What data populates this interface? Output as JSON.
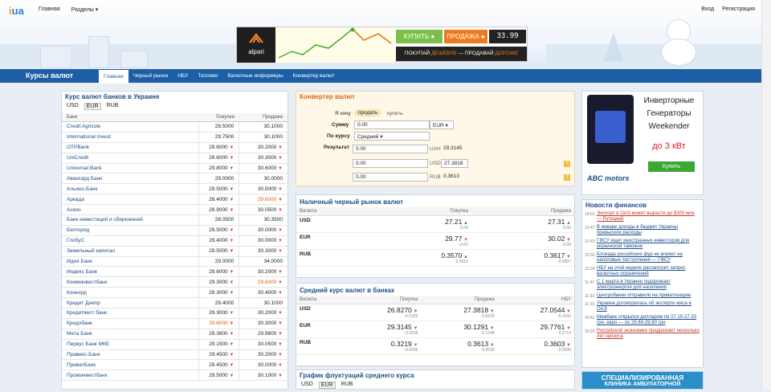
{
  "site": {
    "logo_main": "i",
    "logo_ua": "ua",
    "nav": [
      "Главная",
      "Разделы ▾"
    ],
    "auth": [
      "Вход",
      "Регистрация"
    ]
  },
  "banner": {
    "brand": "alpari",
    "buy": "КУПИТЬ ●",
    "sell": "ПРОДАЖА ●",
    "ticker": "33.99",
    "slogan_pre": "ПОКУПАЙ ",
    "slogan_cheap": "ДЕШЕВЛЕ",
    "slogan_mid": " — ПРОДАВАЙ ",
    "slogan_dear": "ДОРОЖЕ"
  },
  "section": {
    "title": "Курсы валют",
    "tabs": [
      "Главная",
      "Черный рынок",
      "НБУ",
      "Топливо",
      "Валютные информеры",
      "Конвертер валют"
    ]
  },
  "banks": {
    "title": "Курс валют банков в Украине",
    "currencies": [
      "USD",
      "EUR",
      "RUB"
    ],
    "headers": [
      "Банк",
      "Покупка",
      "Продажа"
    ],
    "rows": [
      [
        "Credit Agricole",
        "29.5000",
        "30.1000",
        "",
        ""
      ],
      [
        "International Invest",
        "29.7500",
        "30.1000",
        "",
        ""
      ],
      [
        "OTPBank",
        "29.6000",
        "30.2000",
        "d",
        "d"
      ],
      [
        "UniCredit",
        "29.6000",
        "30.3000",
        "d",
        "d"
      ],
      [
        "Universal Bank",
        "29.8000",
        "30.6000",
        "d",
        "d"
      ],
      [
        "Авангард Банк",
        "29.0000",
        "30.0000",
        "",
        ""
      ],
      [
        "Альянс-Банк",
        "29.5000",
        "30.5000",
        "d",
        "d"
      ],
      [
        "Аркада",
        "28.4000",
        "29.6000",
        "d",
        "h"
      ],
      [
        "Аскио",
        "28.9000",
        "30.0500",
        "d",
        "d"
      ],
      [
        "Банк инвестиций и сбережений",
        "28.0500",
        "30.3500",
        "",
        ""
      ],
      [
        "Белгород",
        "29.5000",
        "30.0000",
        "d",
        "d"
      ],
      [
        "ГлобуС",
        "29.4000",
        "30.0000",
        "d",
        "d"
      ],
      [
        "Земельный капитал",
        "29.5000",
        "30.3000",
        "d",
        "d"
      ],
      [
        "Идея Банк",
        "29.0000",
        "34.0000",
        "",
        ""
      ],
      [
        "Индекс Банк",
        "29.6000",
        "30.2000",
        "d",
        "d"
      ],
      [
        "Комминвестбанк",
        "29.3000",
        "29.6000",
        "d",
        "h"
      ],
      [
        "Конкорд",
        "29.3000",
        "30.4000",
        "d",
        "d"
      ],
      [
        "Кредит Днепр",
        "29.4000",
        "30.1000",
        "",
        ""
      ],
      [
        "Кредитвест банк",
        "29.3000",
        "30.2000",
        "d",
        "d"
      ],
      [
        "Кредобанк",
        "29.8000",
        "30.3000",
        "h",
        "d"
      ],
      [
        "Мета Банк",
        "29.3800",
        "29.9800",
        "d",
        "d"
      ],
      [
        "Первус Банк МКБ",
        "29.1500",
        "30.0500",
        "d",
        "d"
      ],
      [
        "Правекс-Банк",
        "29.4500",
        "30.2000",
        "d",
        "d"
      ],
      [
        "ПриватБанк",
        "29.4500",
        "30.0000",
        "d",
        "d"
      ],
      [
        "Проминвестбанк",
        "29.5000",
        "30.1000",
        "d",
        "d"
      ]
    ]
  },
  "converter": {
    "title": "Конвертер валют",
    "want_label": "Я хочу",
    "sell": "продать",
    "buy": "купить",
    "sum_label": "Сумму",
    "sum_value": "0.00",
    "sum_currency": "EUR ▾",
    "rate_label": "По курсу",
    "rate_value": "Средний ▾",
    "result_label": "Результат",
    "results": [
      [
        "0.00",
        "UAH",
        "29.3145"
      ],
      [
        "0.00",
        "USD",
        "27.3818"
      ],
      [
        "0.00",
        "RUB",
        "0.3613"
      ]
    ],
    "q": "?"
  },
  "black": {
    "title": "Наличный черный рынок валют",
    "headers": [
      "Валюта",
      "Покупка",
      "Продажа"
    ],
    "rows": [
      {
        "cur": "USD",
        "buy": "27.21",
        "buy_d": "0.04",
        "sell": "27.31",
        "sell_d": "0.06"
      },
      {
        "cur": "EUR",
        "buy": "29.77",
        "buy_d": "-0.02",
        "sell": "30.02",
        "sell_d": "-0.08"
      },
      {
        "cur": "RUB",
        "buy": "0.3570",
        "buy_d": "0.0016",
        "sell": "0.3617",
        "sell_d": "-0.0007"
      }
    ]
  },
  "average": {
    "title": "Средний курс валют в банках",
    "headers": [
      "Валюта",
      "Покупка",
      "Продажа",
      "НБУ"
    ],
    "rows": [
      {
        "cur": "USD",
        "buy": "26.8270",
        "buy_d": "-0.0185",
        "sell": "27.3818",
        "sell_d": "-0.0539",
        "nbu": "27.0544",
        "nbu_d": "-0.1643"
      },
      {
        "cur": "EUR",
        "buy": "29.3145",
        "buy_d": "-0.0536",
        "sell": "30.1291",
        "sell_d": "-0.1248",
        "nbu": "29.7761",
        "nbu_d": "-0.2710"
      },
      {
        "cur": "RUB",
        "buy": "0.3219",
        "buy_d": "-0.0002",
        "sell": "0.3613",
        "sell_d": "-0.0035",
        "nbu": "0.3603",
        "nbu_d": "-0.0036"
      }
    ]
  },
  "graph": {
    "title": "График флуктуаций среднего курса",
    "currencies": [
      "USD",
      "EUR",
      "RUB"
    ]
  },
  "ad": {
    "line1": "Инверторные",
    "line2": "Генераторы",
    "line3": "Weekender",
    "power": "до 3 кВт",
    "button": "Купить",
    "brand": "ABC motors"
  },
  "news": {
    "title": "Новости финансов",
    "items": [
      [
        "10:01",
        "Экспорт в ОАЭ может вырасти до $300 млн — Рутицкий",
        true
      ],
      [
        "12:47",
        "В январе доходы в бюджет Украины превысили расходы",
        false
      ],
      [
        "12:43",
        "ГФСУ ищет иностранных инвесторов для украинской таможни",
        false
      ],
      [
        "12:33",
        "Блокада российских фур не влияет на налоговые поступления — ГФСУ",
        false
      ],
      [
        "12:24",
        "НБУ на этой неделе рассмотрит запрос валютных ограничений",
        false
      ],
      [
        "11:47",
        "С 1 марта в Украине подорожает электроэнергия для населения",
        false
      ],
      [
        "11:33",
        "Центробанки отправили на приватизацию",
        false
      ],
      [
        "11:10",
        "Украина договорилась об экспорте мяса в ОАЭ",
        false
      ],
      [
        "10:41",
        "Межбанк открылся долларом по 27.10-27.20 грн, евро — по 29.69-29.80 грн",
        false
      ],
      [
        "10:22",
        "Российской экономике предрекают несколько лет кризиса",
        true
      ]
    ]
  },
  "ad2": {
    "line1": "СПЕЦИАЛИЗИРОВАННАЯ",
    "line2": "КЛИНИКА АМБУЛАТОРНОЙ"
  }
}
